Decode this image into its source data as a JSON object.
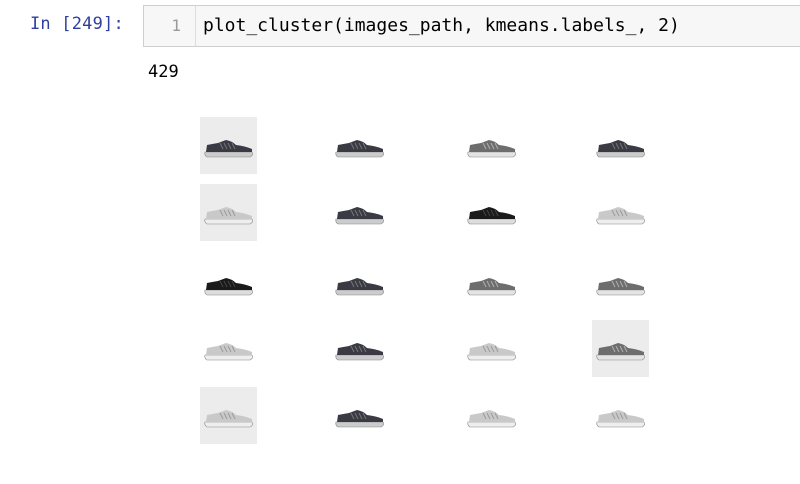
{
  "cell": {
    "prompt": "In [249]:",
    "line_number": "1",
    "code": "plot_cluster(images_path, kmeans.labels_, 2)"
  },
  "output": {
    "text": "429"
  },
  "figure": {
    "rows": [
      [
        {
          "icon": "dark-sneaker-icon",
          "tone": "dark",
          "bg": true
        },
        {
          "icon": "dark-running-shoe-icon",
          "tone": "dark",
          "bg": false
        },
        {
          "icon": "speckled-running-shoe-icon",
          "tone": "mixed",
          "bg": false
        },
        {
          "icon": "dark-running-shoe-icon",
          "tone": "dark",
          "bg": false
        }
      ],
      [
        {
          "icon": "white-sneaker-icon",
          "tone": "light",
          "bg": true
        },
        {
          "icon": "dark-running-shoe-icon",
          "tone": "dark",
          "bg": false
        },
        {
          "icon": "black-sneaker-icon",
          "tone": "black",
          "bg": false
        },
        {
          "icon": "white-running-shoe-icon",
          "tone": "light",
          "bg": false
        }
      ],
      [
        {
          "icon": "black-sneaker-icon",
          "tone": "black",
          "bg": false
        },
        {
          "icon": "dark-sneaker-icon",
          "tone": "dark",
          "bg": false
        },
        {
          "icon": "grey-running-shoe-icon",
          "tone": "mixed",
          "bg": false
        },
        {
          "icon": "speckled-running-shoe-icon",
          "tone": "mixed",
          "bg": false
        }
      ],
      [
        {
          "icon": "grey-running-shoe-icon",
          "tone": "light",
          "bg": false
        },
        {
          "icon": "striped-sneaker-icon",
          "tone": "dark",
          "bg": false
        },
        {
          "icon": "white-running-shoe-icon",
          "tone": "light",
          "bg": false
        },
        {
          "icon": "grey-running-shoe-icon",
          "tone": "mixed",
          "bg": true
        }
      ],
      [
        {
          "icon": "white-sneaker-icon",
          "tone": "light",
          "bg": true
        },
        {
          "icon": "dark-running-shoe-icon",
          "tone": "dark",
          "bg": false
        },
        {
          "icon": "grey-running-shoe-icon",
          "tone": "light",
          "bg": false
        },
        {
          "icon": "white-running-shoe-icon",
          "tone": "light",
          "bg": false
        }
      ]
    ]
  },
  "colors": {
    "prompt": "#303f9f",
    "input_bg": "#f7f7f7",
    "input_border": "#cfcfcf",
    "line_number": "#999999",
    "thumb_bg": "#ececec"
  }
}
